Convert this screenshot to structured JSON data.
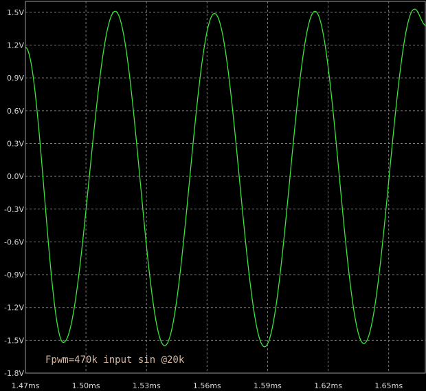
{
  "chart_data": {
    "type": "line",
    "title": "",
    "xlabel": "",
    "ylabel": "",
    "xlim": [
      1.47,
      1.6685
    ],
    "ylim": [
      -1.8,
      1.6
    ],
    "grid": true,
    "background": "#000000",
    "grid_color": "#7a7a7a",
    "axis_text_color": "#d8d8d8",
    "x_ticks": [
      {
        "value": 1.47,
        "label": "1.47ms"
      },
      {
        "value": 1.5,
        "label": "1.50ms"
      },
      {
        "value": 1.53,
        "label": "1.53ms"
      },
      {
        "value": 1.56,
        "label": "1.56ms"
      },
      {
        "value": 1.59,
        "label": "1.59ms"
      },
      {
        "value": 1.62,
        "label": "1.62ms"
      },
      {
        "value": 1.65,
        "label": "1.65ms"
      }
    ],
    "y_ticks": [
      {
        "value": 1.5,
        "label": "1.5V"
      },
      {
        "value": 1.2,
        "label": "1.2V"
      },
      {
        "value": 0.9,
        "label": "0.9V"
      },
      {
        "value": 0.6,
        "label": "0.6V"
      },
      {
        "value": 0.3,
        "label": "0.3V"
      },
      {
        "value": 0.0,
        "label": "0.0V"
      },
      {
        "value": -0.3,
        "label": "-0.3V"
      },
      {
        "value": -0.6,
        "label": "-0.6V"
      },
      {
        "value": -0.9,
        "label": "-0.9V"
      },
      {
        "value": -1.2,
        "label": "-1.2V"
      },
      {
        "value": -1.5,
        "label": "-1.5V"
      },
      {
        "value": -1.8,
        "label": "-1.8V"
      }
    ],
    "annotation": {
      "text": "Fpwm=470k input sin @20k",
      "color": "#d7b7a0"
    },
    "series": [
      {
        "color": "#39e639",
        "extrema": [
          {
            "t": 1.47,
            "v": 1.18
          },
          {
            "t": 1.4888,
            "v": -1.52
          },
          {
            "t": 1.5145,
            "v": 1.51
          },
          {
            "t": 1.539,
            "v": -1.55
          },
          {
            "t": 1.5637,
            "v": 1.49
          },
          {
            "t": 1.5885,
            "v": -1.56
          },
          {
            "t": 1.6135,
            "v": 1.51
          },
          {
            "t": 1.6377,
            "v": -1.53
          },
          {
            "t": 1.6628,
            "v": 1.53
          },
          {
            "t": 1.6685,
            "v": 1.38
          }
        ]
      }
    ]
  }
}
